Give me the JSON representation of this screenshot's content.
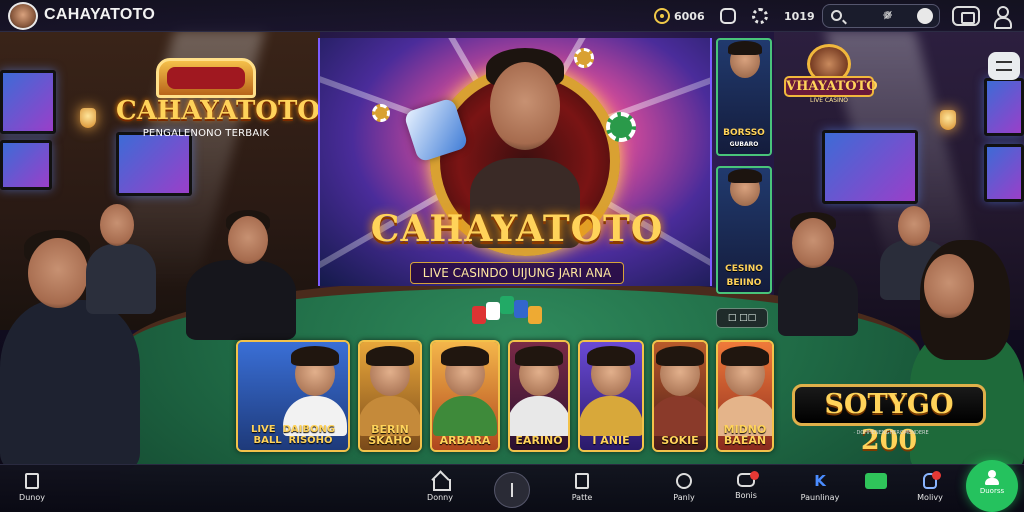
{
  "topbar": {
    "brand": "CAHAYATOTO",
    "balance": "6006",
    "stat": "1019",
    "search_filter": "❁̸"
  },
  "left_sign": {
    "title": "CAHAYATOTO",
    "subtitle": "PENGALENONO TERBAIK"
  },
  "right_sign": {
    "title": "VHAYATOTO",
    "subtitle": "LIVE CASINO"
  },
  "hero": {
    "title": "CAHAYATOTO",
    "subtitle": "LIVE CASINDO UIJUNG JARI ANA"
  },
  "side_cards": [
    {
      "label": "BORSSO",
      "sublabel": "GUBARO"
    },
    {
      "label": "CESINO",
      "sublabel": "BEIINO"
    }
  ],
  "pill": "□ □□",
  "tiles": [
    {
      "label": "LIVE  DAIBONG\nBALL  RISOHO"
    },
    {
      "label": "BERIN\nSKAHO"
    },
    {
      "label": "ARBARA"
    },
    {
      "label": "EARINO"
    },
    {
      "label": "I ANIE"
    },
    {
      "label": "SOKIE"
    },
    {
      "label": "MIDNO\nBAEAN"
    }
  ],
  "promo": {
    "title": "SOTYGO 200",
    "subtitle": "· DOHHENENGHEROMENDERE"
  },
  "bottom_nav": [
    {
      "label": "Dunoy"
    },
    {
      "label": "Donny"
    },
    {
      "label": "Patte"
    },
    {
      "label": "Panly"
    },
    {
      "label": "Bonis"
    },
    {
      "label": "Paunlinay"
    },
    {
      "label": ""
    },
    {
      "label": "Molivy"
    },
    {
      "label": "Duorss"
    }
  ],
  "colors": {
    "accent_gold": "#ffd35a",
    "felt_green": "#1f6a45",
    "fab_green": "#25c25e",
    "badge_red": "#e53935"
  }
}
